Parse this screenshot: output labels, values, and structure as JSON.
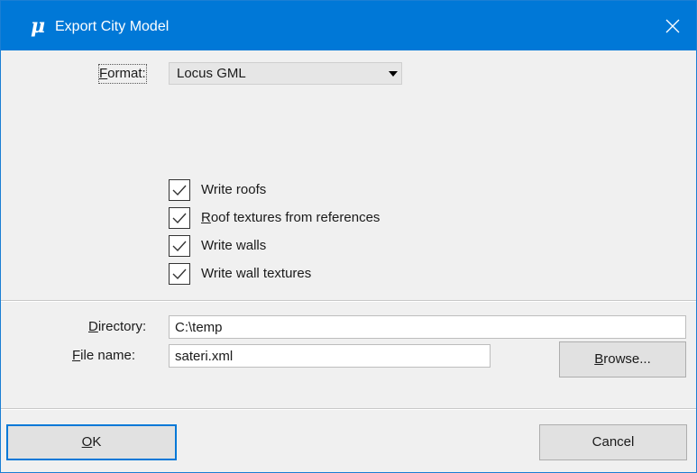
{
  "window": {
    "title": "Export City Model",
    "app_icon_glyph": "μ",
    "icon": "microstation-app-icon",
    "close_icon": "close-icon"
  },
  "format": {
    "label_mnemonic": "F",
    "label_rest": "ormat:",
    "selected": "Locus GML",
    "arrow_icon": "dropdown-arrow-icon"
  },
  "options": [
    {
      "prefix": "",
      "mnemonic": "",
      "rest": "Write roofs",
      "checked": true
    },
    {
      "prefix": "",
      "mnemonic": "R",
      "rest": "oof textures from references",
      "checked": true
    },
    {
      "prefix": "",
      "mnemonic": "",
      "rest": "Write walls",
      "checked": true
    },
    {
      "prefix": "",
      "mnemonic": "",
      "rest": "Write wall textures",
      "checked": true
    }
  ],
  "directory": {
    "label_mnemonic": "D",
    "label_rest": "irectory:",
    "value": "C:\\temp"
  },
  "filename": {
    "label_mnemonic": "F",
    "label_rest": "ile name:",
    "value": "sateri.xml"
  },
  "browse": {
    "mnemonic": "B",
    "rest": "rowse..."
  },
  "ok": {
    "mnemonic": "O",
    "rest": "K"
  },
  "cancel": {
    "label": "Cancel"
  },
  "colors": {
    "titlebar": "#0078d7",
    "dialog_bg": "#f0f0f0",
    "default_button_border": "#0078d7"
  }
}
